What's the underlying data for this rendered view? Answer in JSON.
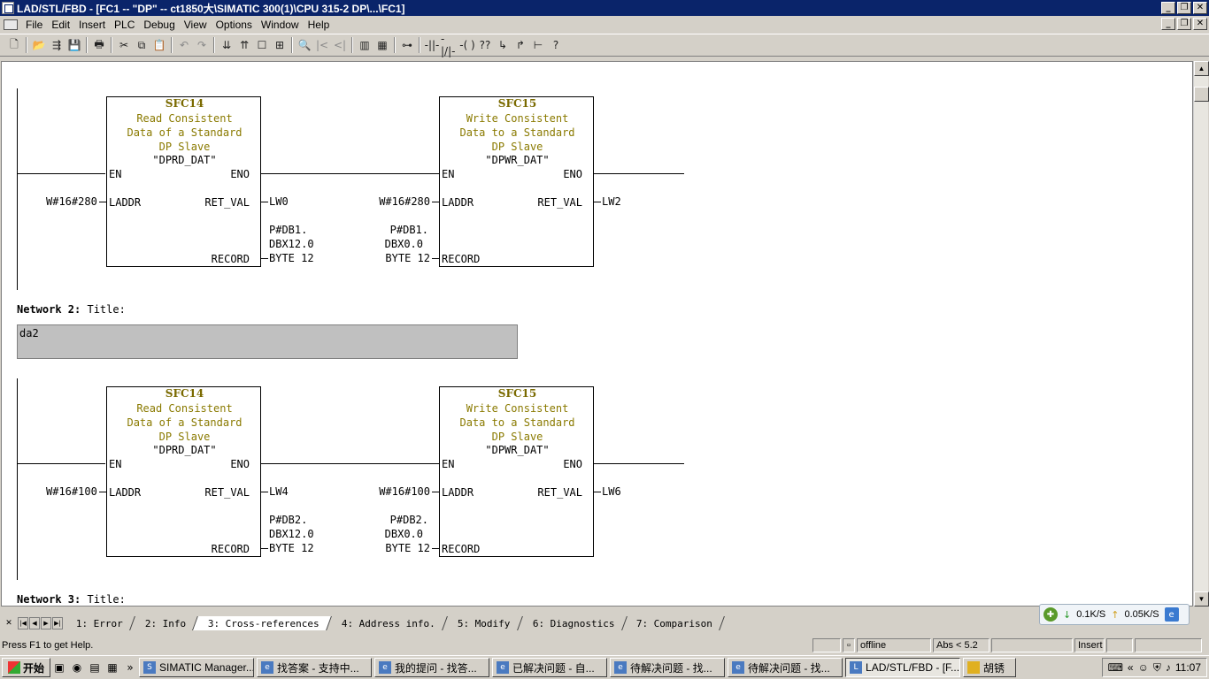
{
  "window": {
    "title": "LAD/STL/FBD  - [FC1 -- \"DP\" -- ct1850大\\SIMATIC 300(1)\\CPU 315-2 DP\\...\\FC1]",
    "min": "_",
    "restore": "❐",
    "close": "✕"
  },
  "menu": {
    "items": [
      {
        "label": "File"
      },
      {
        "label": "Edit"
      },
      {
        "label": "Insert"
      },
      {
        "label": "PLC"
      },
      {
        "label": "Debug"
      },
      {
        "label": "View"
      },
      {
        "label": "Options"
      },
      {
        "label": "Window"
      },
      {
        "label": "Help"
      }
    ]
  },
  "toolbar": {
    "icons": [
      "new-icon",
      "open-icon",
      "accessible-nodes-icon",
      "save-icon",
      "print-icon",
      "cut-icon",
      "copy-icon",
      "paste-icon",
      "undo-icon",
      "redo-icon",
      "download-icon",
      "upload-icon",
      "overview-icon",
      "monitor-icon",
      "find-icon",
      "prev-error-icon",
      "next-error-icon",
      "lad-view-icon",
      "fbd-view-icon",
      "new-network-icon",
      "contact-no-icon",
      "contact-nc-icon",
      "coil-icon",
      "empty-box-icon",
      "branch-open-icon",
      "branch-close-icon",
      "connection-icon",
      "help-icon"
    ],
    "glyphs": [
      "🗋",
      "📂",
      "⇶",
      "💾",
      "🖶",
      "✂",
      "⧉",
      "📋",
      "↶",
      "↷",
      "⇊",
      "⇈",
      "☐",
      "⊞",
      "🔍",
      "|<",
      "<|",
      "▥",
      "▦",
      "⊶",
      "-||-",
      "-|/|-",
      "-( )",
      "??",
      "↳",
      "↱",
      "⊢",
      "?"
    ]
  },
  "networks": [
    {
      "block1": {
        "num": "SFC14",
        "desc": "Read Consistent\nData of a Standard\nDP Slave",
        "sym": "\"DPRD_DAT\"",
        "en": "EN",
        "eno": "ENO",
        "laddr": "LADDR",
        "ret_val": "RET_VAL",
        "record": "RECORD",
        "laddr_val": "W#16#280",
        "ret_val_out": "LW0",
        "record_val": [
          "P#DB1.",
          "DBX12.0",
          "BYTE 12"
        ]
      },
      "block2": {
        "num": "SFC15",
        "desc": "Write Consistent\nData to a Standard\nDP Slave",
        "sym": "\"DPWR_DAT\"",
        "en": "EN",
        "eno": "ENO",
        "laddr": "LADDR",
        "ret_val": "RET_VAL",
        "record": "RECORD",
        "laddr_val": "W#16#280",
        "ret_val_out": "LW2",
        "record_val": [
          "P#DB1.",
          "DBX0.0",
          "BYTE 12"
        ]
      }
    },
    {
      "header_label": "Network 2",
      "header_title": "Title:",
      "comment": "da2",
      "block1": {
        "num": "SFC14",
        "desc": "Read Consistent\nData of a Standard\nDP Slave",
        "sym": "\"DPRD_DAT\"",
        "en": "EN",
        "eno": "ENO",
        "laddr": "LADDR",
        "ret_val": "RET_VAL",
        "record": "RECORD",
        "laddr_val": "W#16#100",
        "ret_val_out": "LW4",
        "record_val": [
          "P#DB2.",
          "DBX12.0",
          "BYTE 12"
        ]
      },
      "block2": {
        "num": "SFC15",
        "desc": "Write Consistent\nData to a Standard\nDP Slave",
        "sym": "\"DPWR_DAT\"",
        "en": "EN",
        "eno": "ENO",
        "laddr": "LADDR",
        "ret_val": "RET_VAL",
        "record": "RECORD",
        "laddr_val": "W#16#100",
        "ret_val_out": "LW6",
        "record_val": [
          "P#DB2.",
          "DBX0.0",
          "BYTE 12"
        ]
      }
    },
    {
      "header_label": "Network 3",
      "header_title": "Title:"
    }
  ],
  "tabs": [
    {
      "label": "1: Error"
    },
    {
      "label": "2: Info"
    },
    {
      "label": "3: Cross-references",
      "active": true
    },
    {
      "label": "4: Address info."
    },
    {
      "label": "5: Modify"
    },
    {
      "label": "6: Diagnostics"
    },
    {
      "label": "7: Comparison"
    }
  ],
  "status": {
    "message": "Press F1 to get Help.",
    "mode": "offline",
    "abs": "Abs < 5.2",
    "insert": "Insert"
  },
  "netspeed": {
    "down": "0.1K/S",
    "up": "0.05K/S"
  },
  "taskbar": {
    "start": "开始",
    "tasks": [
      {
        "label": "SIMATIC Manager..."
      },
      {
        "label": "找答案 - 支持中..."
      },
      {
        "label": "我的提问 - 找答..."
      },
      {
        "label": "已解决问题 - 自..."
      },
      {
        "label": "待解决问题 - 找..."
      },
      {
        "label": "待解决问题 - 找..."
      },
      {
        "label": "LAD/STL/FBD - [F...",
        "active": true
      },
      {
        "label": "胡锈"
      }
    ],
    "clock": "11:07"
  }
}
